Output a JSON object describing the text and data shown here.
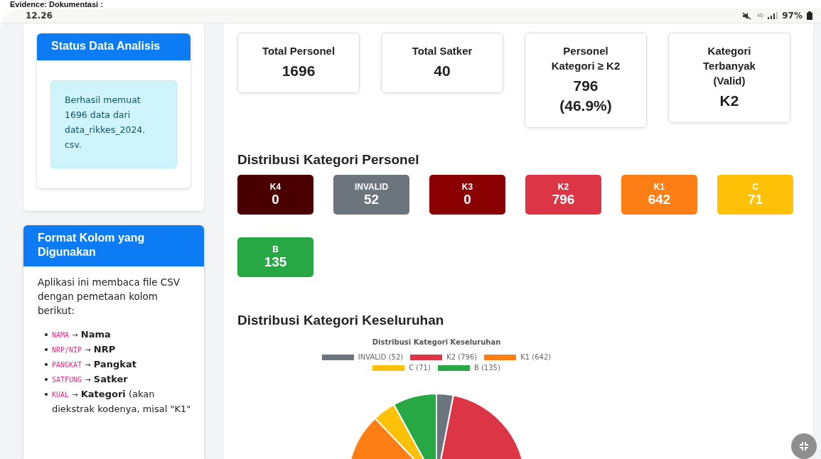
{
  "caption": "Evidence: Dokumentasi :",
  "status_bar": {
    "time": "12.26",
    "network": "4G",
    "battery": "97%"
  },
  "sidebar": {
    "panels": [
      {
        "kind": "status",
        "title": "Status Data Analisis",
        "message": "Berhasil memuat 1696 data dari data_rikkes_2024.csv."
      },
      {
        "kind": "format",
        "title": "Format Kolom yang Digunakan",
        "intro": "Aplikasi ini membaca file CSV dengan pemetaan kolom berikut:",
        "items": [
          {
            "source": "NAMA",
            "arrow": "→",
            "target": "Nama"
          },
          {
            "source": "NRP/NIP",
            "arrow": "→",
            "target": "NRP"
          },
          {
            "source": "PANGKAT",
            "arrow": "→",
            "target": "Pangkat"
          },
          {
            "source": "SATFUNG",
            "arrow": "→",
            "target": "Satker"
          },
          {
            "source": "KUAL",
            "arrow": "→",
            "target": "Kategori",
            "note": "(akan diekstrak kodenya, misal \"K1\""
          }
        ]
      }
    ]
  },
  "stats": [
    {
      "label": "Total Personel",
      "value": "1696"
    },
    {
      "label": "Total Satker",
      "value": "40"
    },
    {
      "label": "Personel Kategori ≥ K2",
      "value": "796 (46.9%)"
    },
    {
      "label": "Kategori Terbanyak (Valid)",
      "value": "K2"
    }
  ],
  "categories_section": {
    "title": "Distribusi Kategori Personel",
    "badges": [
      {
        "label": "K4",
        "count": "0",
        "color": "#4a0000"
      },
      {
        "label": "INVALID",
        "count": "52",
        "color": "#6c757d"
      },
      {
        "label": "K3",
        "count": "0",
        "color": "#8b0000"
      },
      {
        "label": "K2",
        "count": "796",
        "color": "#dc3545"
      },
      {
        "label": "K1",
        "count": "642",
        "color": "#fd7e14"
      },
      {
        "label": "C",
        "count": "71",
        "color": "#ffc107"
      },
      {
        "label": "B",
        "count": "135",
        "color": "#28a745"
      }
    ]
  },
  "overall_section": {
    "title": "Distribusi Kategori Keseluruhan",
    "legend": [
      {
        "color": "#6c757d"
      },
      {
        "color": "#dc3545"
      },
      {
        "color": "#fd7e14"
      },
      {
        "color": "#ffc107"
      },
      {
        "color": "#28a745"
      }
    ],
    "chart_data": {
      "type": "pie",
      "legend": "top",
      "title": "Distribusi Kategori Keseluruhan",
      "categories": [
        "INVALID (52)",
        "K2 (796)",
        "K1 (642)",
        "C (71)",
        "B (135)"
      ],
      "values": [
        52,
        796,
        642,
        71,
        135
      ]
    }
  }
}
